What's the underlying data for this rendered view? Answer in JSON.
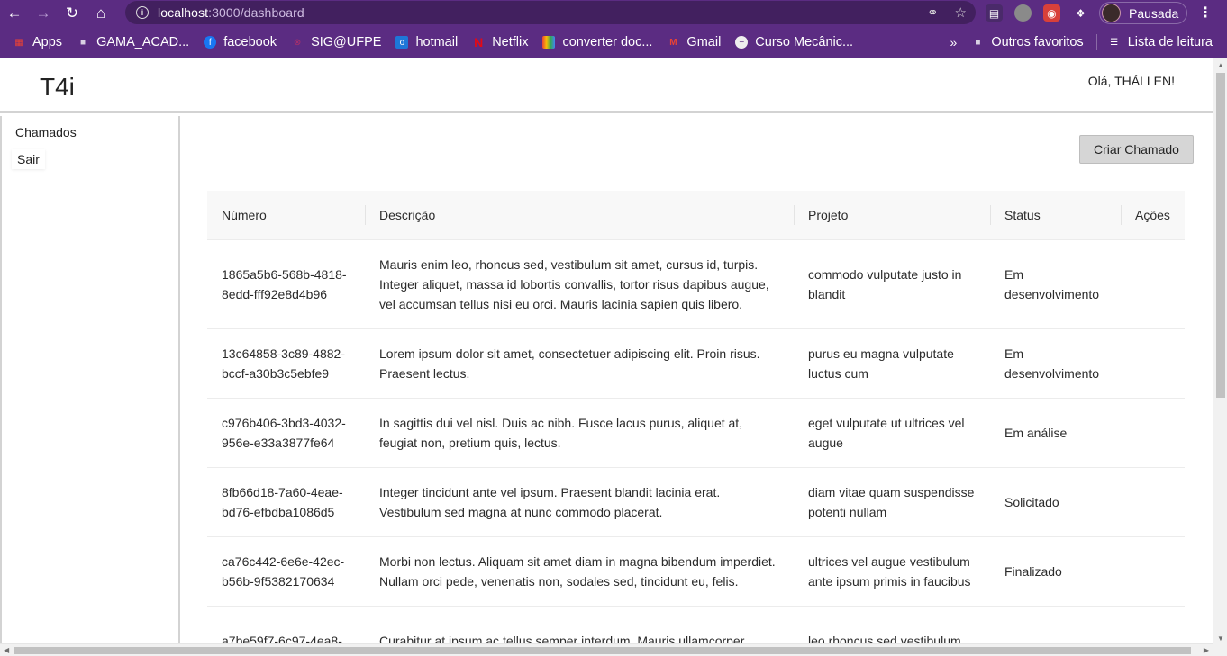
{
  "browser": {
    "url_host": "localhost",
    "url_path": ":3000/dashboard",
    "profile_label": "Pausada",
    "bookmarks": [
      {
        "label": "Apps",
        "icon": "apps-grid-icon",
        "color": "#e94235"
      },
      {
        "label": "GAMA_ACAD...",
        "icon": "folder-icon",
        "color": "#d9d0e3"
      },
      {
        "label": "facebook",
        "icon": "facebook-icon",
        "color": "#1877f2"
      },
      {
        "label": "SIG@UFPE",
        "icon": "sig-icon",
        "color": "#b0306a"
      },
      {
        "label": "hotmail",
        "icon": "outlook-icon",
        "color": "#1e77d8"
      },
      {
        "label": "Netflix",
        "icon": "netflix-icon",
        "color": "#e50914"
      },
      {
        "label": "converter doc...",
        "icon": "converter-icon",
        "color": "#f4b400"
      },
      {
        "label": "Gmail",
        "icon": "gmail-icon",
        "color": "#ea4335"
      },
      {
        "label": "Curso Mecânic...",
        "icon": "course-icon",
        "color": "#eeeeee"
      }
    ],
    "other_favorites": "Outros favoritos",
    "reading_list": "Lista de leitura"
  },
  "header": {
    "brand": "T4i",
    "greeting": "Olá, THÁLLEN!"
  },
  "sidebar": {
    "items": [
      {
        "label": "Chamados"
      },
      {
        "label": "Sair"
      }
    ]
  },
  "main": {
    "create_button": "Criar Chamado",
    "table": {
      "columns": [
        "Número",
        "Descrição",
        "Projeto",
        "Status",
        "Ações"
      ],
      "rows": [
        {
          "numero": "1865a5b6-568b-4818-8edd-fff92e8d4b96",
          "descricao": "Mauris enim leo, rhoncus sed, vestibulum sit amet, cursus id, turpis. Integer aliquet, massa id lobortis convallis, tortor risus dapibus augue, vel accumsan tellus nisi eu orci. Mauris lacinia sapien quis libero.",
          "projeto": "commodo vulputate justo in blandit",
          "status": "Em desenvolvimento"
        },
        {
          "numero": "13c64858-3c89-4882-bccf-a30b3c5ebfe9",
          "descricao": "Lorem ipsum dolor sit amet, consectetuer adipiscing elit. Proin risus. Praesent lectus.",
          "projeto": "purus eu magna vulputate luctus cum",
          "status": "Em desenvolvimento"
        },
        {
          "numero": "c976b406-3bd3-4032-956e-e33a3877fe64",
          "descricao": "In sagittis dui vel nisl. Duis ac nibh. Fusce lacus purus, aliquet at, feugiat non, pretium quis, lectus.",
          "projeto": "eget vulputate ut ultrices vel augue",
          "status": "Em análise"
        },
        {
          "numero": "8fb66d18-7a60-4eae-bd76-efbdba1086d5",
          "descricao": "Integer tincidunt ante vel ipsum. Praesent blandit lacinia erat. Vestibulum sed magna at nunc commodo placerat.",
          "projeto": "diam vitae quam suspendisse potenti nullam",
          "status": "Solicitado"
        },
        {
          "numero": "ca76c442-6e6e-42ec-b56b-9f5382170634",
          "descricao": "Morbi non lectus. Aliquam sit amet diam in magna bibendum imperdiet. Nullam orci pede, venenatis non, sodales sed, tincidunt eu, felis.",
          "projeto": "ultrices vel augue vestibulum ante ipsum primis in faucibus",
          "status": "Finalizado"
        },
        {
          "numero": "a7be59f7-6c97-4ea8-",
          "descricao": "Curabitur at ipsum ac tellus semper interdum. Mauris ullamcorper",
          "projeto": "leo rhoncus sed vestibulum",
          "status": ""
        }
      ]
    }
  }
}
